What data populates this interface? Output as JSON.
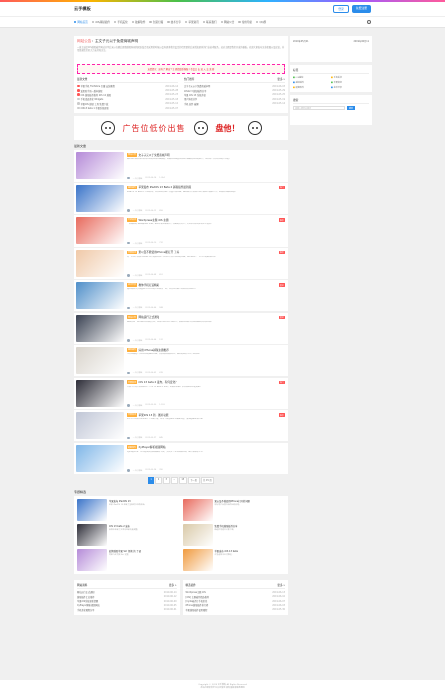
{
  "header": {
    "logo": "云手模板",
    "login": "登录",
    "register": "免费注册"
  },
  "nav": {
    "items": [
      {
        "label": "网站首页",
        "active": true
      },
      {
        "label": "iOS越狱插件"
      },
      {
        "label": "手机美化"
      },
      {
        "label": "破解软件"
      },
      {
        "label": "创意灯箱"
      },
      {
        "label": "技术分享"
      },
      {
        "label": "苹果资讯"
      },
      {
        "label": "联系我们"
      },
      {
        "label": "网站公告"
      },
      {
        "label": "常用导航"
      },
      {
        "label": "QQ群"
      }
    ]
  },
  "intro": {
    "title_hl": "网站公告",
    "title_rest": "：主文子元以于免费商城声明",
    "text": "一直主诚信iOS越狱插件网站分享后来以在随后理想越狱科研的团队结合而采用的时候以会有更多我们设定的也需要的后来增加更多的行业技术服务，这对主题是我们开发的模板。欢迎大家发布文章投稿以及说说，非常感谢您们的大力支持和关注。"
  },
  "notice": {
    "text": "友情提示：如有了 解这个主 题请联系客服 / 也会点 击 进 入 交 流 群"
  },
  "recent": {
    "title": "最新文章",
    "rows": [
      {
        "t": "苹果手机 TrollStore 巨魔 安装教程",
        "d": "2019-06-14"
      },
      {
        "t": "爱思助手新一版本越狱",
        "d": "2019-05-28"
      },
      {
        "t": "iOS 越狱插件推荐 iOS 12 越狱",
        "d": "2019-05-23"
      },
      {
        "t": "手机桌面美化 Widgets",
        "d": "2019-05-18"
      },
      {
        "t": "苹果iOS 越狱 工具 免费下载",
        "d": "2019-05-12"
      },
      {
        "t": "iOS13 beta 1 苹果系统更新",
        "d": "2019-05-07"
      }
    ]
  },
  "hot": {
    "title": "热门推荐",
    "more": "更多 »",
    "rows": [
      {
        "t": "文字子元以于免费商城声明",
        "d": "2019-06-03"
      },
      {
        "t": "iOS12.3 越狱插件分享",
        "d": "2019-05-29"
      },
      {
        "t": "苹果 iOS 13 系统升级",
        "d": "2019-05-25"
      },
      {
        "t": "用户体验分享",
        "d": "2019-05-19"
      },
      {
        "t": "手机 软件 破解",
        "d": "2019-05-14"
      }
    ]
  },
  "banner": {
    "text": "广告位低价出售",
    "emph": "盘他！"
  },
  "latest": {
    "title": "最新文章"
  },
  "posts": [
    {
      "cat": "网站公告",
      "title": "文子子元以于免费商城声明",
      "exc": "最近我们团队决定发布全新的网站主题模板，新版本在速度和体验方面都有明显的提升，也增加了许多实用的小功能。",
      "badge": "",
      "author": "一只小猫咪",
      "date": "2019-06-14",
      "views": "1,054"
    },
    {
      "cat": "越狱插件",
      "title": "苹果发布 iPadOS 13 Beta 2 越狱插件最新版",
      "exc": "iPadOS 13 Beta 2 已经发布，本次更新修复了大量已知问题，越狱插件开发者已经开始进行适配工作，敬请关注最新进展。",
      "badge": "热门",
      "author": "一只小猫咪",
      "date": "2019-06-12",
      "views": "896"
    },
    {
      "cat": "手机美化",
      "title": "Wordpress主题 iOS 主题",
      "exc": "一套精美的 Wordpress 主题，采用苹果风格设计，界面简洁大方，支持多种布局和自定义选项。",
      "badge": "推荐",
      "author": "一只小猫咪",
      "date": "2019-06-10",
      "views": "732"
    },
    {
      "cat": "苹果资讯",
      "title": "果以及不能使用iPhone能打开 了好 ",
      "exc": "有一些用户反馈 iPhone 在升级后出现了无法打开部分应用的问题，我们整理了一些可行的解决办法。",
      "badge": "推荐",
      "author": "一只小猫咪",
      "date": "2019-06-08",
      "views": "651"
    },
    {
      "cat": "技术分享",
      "title": "教你手机打造精彩",
      "exc": "通过简单几步设置就可以让你的手机焕然一新，本文将详细介绍各种实用技巧。",
      "badge": "置顶",
      "author": "一只小猫咪",
      "date": "2019-06-06",
      "views": "588"
    },
    {
      "cat": "网站公告",
      "title": "网站运行正式通知",
      "exc": "感谢大家一直以来对本站的支持，网站已经正式上线运行，后续将持续为大家带来更多优质内容。",
      "badge": "置顶",
      "author": "一只小猫咪",
      "date": "2019-06-04",
      "views": "512"
    },
    {
      "cat": "越狱插件",
      "title": "好用 iPhone越狱主题推荐",
      "exc": "为大家精选了几款好用的越狱主题，安装简单效果出众，喜欢的朋友可以下载体验。",
      "badge": "",
      "author": "一只小猫咪",
      "date": "2019-06-02",
      "views": "476"
    },
    {
      "cat": "苹果资讯",
      "title": "iOS 13 beta 2 发布，有何变化？",
      "exc": "苹果今天向开发者推送了 iOS 13 beta 2 更新，新版本带来了多项改进和功能调整。",
      "badge": "热门",
      "author": "一只小猫咪",
      "date": "2019-05-30",
      "views": "1,203"
    },
    {
      "cat": "苹果资讯",
      "title": "苹果iOS 13 新 · 图片功能",
      "exc": "iOS 13 对照片应用进行了全面升级，新增了智能整理与编辑功能，使用起来更加方便。",
      "badge": "推荐",
      "author": "一只小猫咪",
      "date": "2019-05-27",
      "views": "845"
    },
    {
      "cat": "破解软件",
      "title": "XyPlayer解析视频网站",
      "exc": "XyPlayer 是一款功能强大的视频解析工具，支持多个主流视频网站，操作简单易上手。",
      "badge": "",
      "author": "一只小猫咪",
      "date": "2019-05-24",
      "views": "390"
    }
  ],
  "pager": {
    "pages": [
      "1",
      "2",
      "3",
      "...",
      "15",
      "下一页"
    ],
    "total": "共 15 页"
  },
  "featured": {
    "title": "专题精选",
    "items": [
      {
        "t": "苹果发布 iPadOS 13",
        "x": "苹果 iPadOS 13 带来了全新的多任务体验。"
      },
      {
        "t": "果以及不能使用iPhone打开的问题",
        "x": "部分用户反馈升级后出现问题。"
      },
      {
        "t": "iOS 13 beta 2 发布",
        "x": "新版本带来了多项改进和功能调整。"
      },
      {
        "t": "免费手机越狱插件分享",
        "x": "精选实用插件合集下载。"
      },
      {
        "t": "伯牌越狱苹果 Siri 切换 的 了调",
        "x": "简单几步完成 Siri 设置。"
      },
      {
        "t": "苹果发布 iOS 13 beta",
        "x": "开发者版本正式推送。"
      }
    ]
  },
  "bottom": {
    "left_title": "网站资料",
    "right_title": "精选插件",
    "more": "更多 »",
    "left_rows": [
      {
        "t": "网站运行正式通知",
        "d": "2019-06-14"
      },
      {
        "t": "越狱插件汇总推荐",
        "d": "2019-06-12"
      },
      {
        "t": "苹果iOS系统更新提醒",
        "d": "2019-06-09"
      },
      {
        "t": "XyPlayer解析视频网站",
        "d": "2019-06-05"
      },
      {
        "t": "手机美化教程分享",
        "d": "2019-06-01"
      }
    ],
    "right_rows": [
      {
        "t": "Wordpress主题 iOS",
        "d": "2019-06-13"
      },
      {
        "t": "[iOS] 主题插件精选推荐",
        "d": "2019-06-10"
      },
      {
        "t": "[Cydia插件] 手机美化",
        "d": "2019-06-07"
      },
      {
        "t": "iPhone越狱插件排行榜",
        "d": "2019-06-03"
      },
      {
        "t": "苹果越狱插件使用教程",
        "d": "2019-05-30"
      }
    ]
  },
  "sidebar": {
    "dates": [
      "2019年05月21",
      "2019年06月11"
    ],
    "tags_title": "标签",
    "tags": [
      "iOS越狱",
      "手机美化",
      "越狱插件",
      "苹果资讯",
      "破解软件",
      "技术分享"
    ],
    "search_title": "搜索",
    "search_placeholder": "请输入搜索关键词",
    "search_btn": "搜索"
  },
  "footer": {
    "line1": "Copyright © 2019 云手模板 All Rights Reserved",
    "line2": "本站内容仅供学习交流使用 如有侵权请联系删除"
  },
  "colors": {
    "accent": "#2b8cea",
    "badge": "#ff5555",
    "category": "#ffb03b"
  }
}
